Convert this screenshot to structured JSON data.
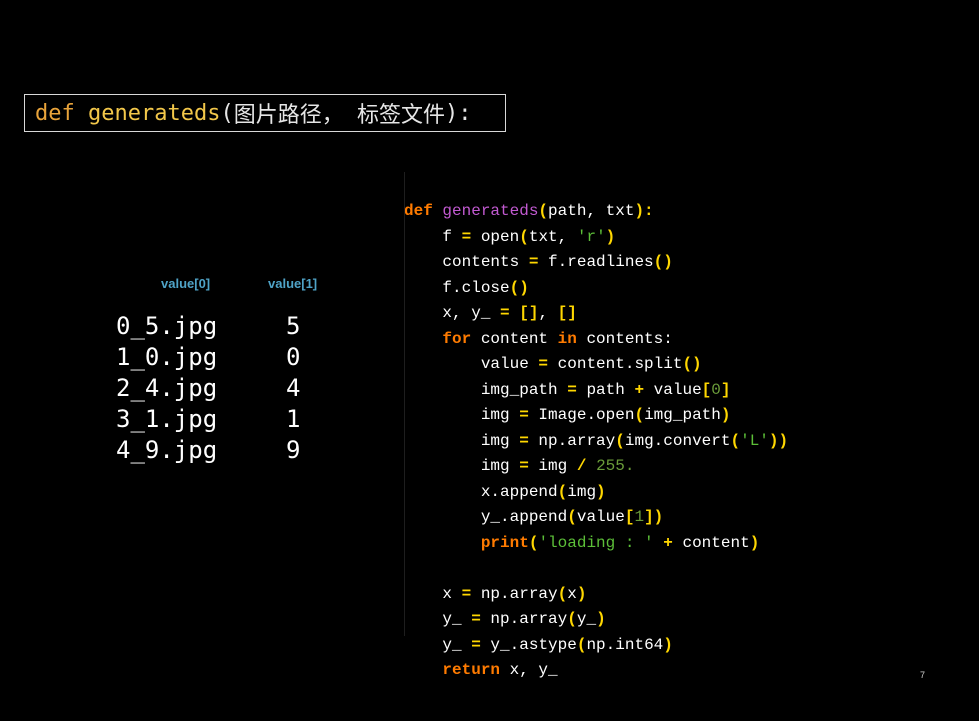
{
  "title": {
    "keyword": "def",
    "function": "generateds",
    "open_paren": "(",
    "params": "图片路径， 标签文件",
    "close": "):"
  },
  "table": {
    "headers": [
      "value[0]",
      "value[1]"
    ],
    "rows": [
      {
        "file": "0_5.jpg",
        "label": "5"
      },
      {
        "file": "1_0.jpg",
        "label": "0"
      },
      {
        "file": "2_4.jpg",
        "label": "4"
      },
      {
        "file": "3_1.jpg",
        "label": "1"
      },
      {
        "file": "4_9.jpg",
        "label": "9"
      }
    ]
  },
  "code": {
    "lines": [
      [
        {
          "t": "def ",
          "c": "def"
        },
        {
          "t": "generateds",
          "c": "fn"
        },
        {
          "t": "(",
          "c": "br"
        },
        {
          "t": "path, txt",
          "c": "tx"
        },
        {
          "t": "):",
          "c": "br"
        }
      ],
      [
        {
          "t": "    f ",
          "c": "tx"
        },
        {
          "t": "=",
          "c": "op"
        },
        {
          "t": " open",
          "c": "tx"
        },
        {
          "t": "(",
          "c": "br"
        },
        {
          "t": "txt, ",
          "c": "tx"
        },
        {
          "t": "'r'",
          "c": "str"
        },
        {
          "t": ")",
          "c": "br"
        }
      ],
      [
        {
          "t": "    contents ",
          "c": "tx"
        },
        {
          "t": "=",
          "c": "op"
        },
        {
          "t": " f.readlines",
          "c": "tx"
        },
        {
          "t": "()",
          "c": "br"
        }
      ],
      [
        {
          "t": "    f.close",
          "c": "tx"
        },
        {
          "t": "()",
          "c": "br"
        }
      ],
      [
        {
          "t": "    x, y_ ",
          "c": "tx"
        },
        {
          "t": "=",
          "c": "op"
        },
        {
          "t": " ",
          "c": "tx"
        },
        {
          "t": "[]",
          "c": "br"
        },
        {
          "t": ", ",
          "c": "tx"
        },
        {
          "t": "[]",
          "c": "br"
        }
      ],
      [
        {
          "t": "    ",
          "c": "tx"
        },
        {
          "t": "for",
          "c": "kw"
        },
        {
          "t": " content ",
          "c": "tx"
        },
        {
          "t": "in",
          "c": "kw"
        },
        {
          "t": " contents:",
          "c": "tx"
        }
      ],
      [
        {
          "t": "        value ",
          "c": "tx"
        },
        {
          "t": "=",
          "c": "op"
        },
        {
          "t": " content.split",
          "c": "tx"
        },
        {
          "t": "()",
          "c": "br"
        }
      ],
      [
        {
          "t": "        img_path ",
          "c": "tx"
        },
        {
          "t": "=",
          "c": "op"
        },
        {
          "t": " path ",
          "c": "tx"
        },
        {
          "t": "+",
          "c": "op"
        },
        {
          "t": " value",
          "c": "tx"
        },
        {
          "t": "[",
          "c": "br"
        },
        {
          "t": "0",
          "c": "num"
        },
        {
          "t": "]",
          "c": "br"
        }
      ],
      [
        {
          "t": "        img ",
          "c": "tx"
        },
        {
          "t": "=",
          "c": "op"
        },
        {
          "t": " Image.open",
          "c": "tx"
        },
        {
          "t": "(",
          "c": "br"
        },
        {
          "t": "img_path",
          "c": "tx"
        },
        {
          "t": ")",
          "c": "br"
        }
      ],
      [
        {
          "t": "        img ",
          "c": "tx"
        },
        {
          "t": "=",
          "c": "op"
        },
        {
          "t": " np.array",
          "c": "tx"
        },
        {
          "t": "(",
          "c": "br"
        },
        {
          "t": "img.convert",
          "c": "tx"
        },
        {
          "t": "(",
          "c": "br"
        },
        {
          "t": "'L'",
          "c": "str"
        },
        {
          "t": "))",
          "c": "br"
        }
      ],
      [
        {
          "t": "        img ",
          "c": "tx"
        },
        {
          "t": "=",
          "c": "op"
        },
        {
          "t": " img ",
          "c": "tx"
        },
        {
          "t": "/",
          "c": "op"
        },
        {
          "t": " ",
          "c": "tx"
        },
        {
          "t": "255.",
          "c": "num"
        }
      ],
      [
        {
          "t": "        x.append",
          "c": "tx"
        },
        {
          "t": "(",
          "c": "br"
        },
        {
          "t": "img",
          "c": "tx"
        },
        {
          "t": ")",
          "c": "br"
        }
      ],
      [
        {
          "t": "        y_.append",
          "c": "tx"
        },
        {
          "t": "(",
          "c": "br"
        },
        {
          "t": "value",
          "c": "tx"
        },
        {
          "t": "[",
          "c": "br"
        },
        {
          "t": "1",
          "c": "num"
        },
        {
          "t": "])",
          "c": "br"
        }
      ],
      [
        {
          "t": "        ",
          "c": "tx"
        },
        {
          "t": "print",
          "c": "kw"
        },
        {
          "t": "(",
          "c": "br"
        },
        {
          "t": "'loading : '",
          "c": "str"
        },
        {
          "t": " ",
          "c": "tx"
        },
        {
          "t": "+",
          "c": "op"
        },
        {
          "t": " content",
          "c": "tx"
        },
        {
          "t": ")",
          "c": "br"
        }
      ],
      [],
      [
        {
          "t": "    x ",
          "c": "tx"
        },
        {
          "t": "=",
          "c": "op"
        },
        {
          "t": " np.array",
          "c": "tx"
        },
        {
          "t": "(",
          "c": "br"
        },
        {
          "t": "x",
          "c": "tx"
        },
        {
          "t": ")",
          "c": "br"
        }
      ],
      [
        {
          "t": "    y_ ",
          "c": "tx"
        },
        {
          "t": "=",
          "c": "op"
        },
        {
          "t": " np.array",
          "c": "tx"
        },
        {
          "t": "(",
          "c": "br"
        },
        {
          "t": "y_",
          "c": "tx"
        },
        {
          "t": ")",
          "c": "br"
        }
      ],
      [
        {
          "t": "    y_ ",
          "c": "tx"
        },
        {
          "t": "=",
          "c": "op"
        },
        {
          "t": " y_.astype",
          "c": "tx"
        },
        {
          "t": "(",
          "c": "br"
        },
        {
          "t": "np.int64",
          "c": "tx"
        },
        {
          "t": ")",
          "c": "br"
        }
      ],
      [
        {
          "t": "    ",
          "c": "tx"
        },
        {
          "t": "return",
          "c": "kw"
        },
        {
          "t": " x, y_",
          "c": "tx"
        }
      ]
    ]
  },
  "page_number": "7",
  "colors": {
    "background": "#000000",
    "keyword": "#ff7b00",
    "function_name": "#c25ad1",
    "string": "#5cbf38",
    "operator": "#ffd700",
    "header_blue": "#4fa3c7"
  }
}
